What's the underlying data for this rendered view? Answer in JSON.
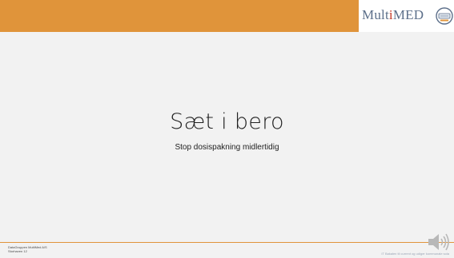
{
  "header": {
    "brand_name": "MultiMED",
    "brand_prefix": "Mult",
    "brand_accent": "i",
    "brand_suffix": "MED",
    "accent_color": "#e0943a"
  },
  "slide": {
    "title": "Sæt i bero",
    "subtitle": "Stop dosispakning midlertidig"
  },
  "footer": {
    "company_line1": "DataGruppen MultiMed A/S",
    "company_line2": "Storhaven 12",
    "notice": "IT Bakalen til current og udiger kommunale sola"
  },
  "icons": {
    "logo": "multimed-logo-icon",
    "audio": "speaker-icon"
  }
}
